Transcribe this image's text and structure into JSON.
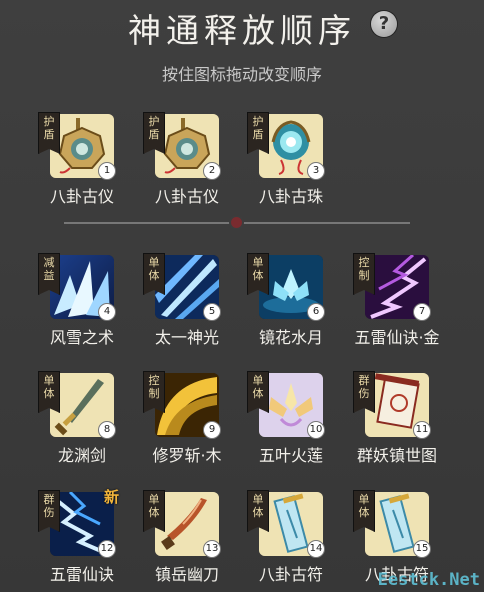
{
  "header": {
    "title": "神通释放顺序",
    "help_icon": "?",
    "subtitle": "按住图标拖动改变顺序"
  },
  "top_skills": [
    {
      "tag": [
        "护",
        "盾"
      ],
      "num": "1",
      "label": "八卦古仪",
      "icon": "bagua-mirror-icon"
    },
    {
      "tag": [
        "护",
        "盾"
      ],
      "num": "2",
      "label": "八卦古仪",
      "icon": "bagua-mirror-icon"
    },
    {
      "tag": [
        "护",
        "盾"
      ],
      "num": "3",
      "label": "八卦古珠",
      "icon": "bagua-orb-icon"
    }
  ],
  "skills": [
    {
      "tag": [
        "减",
        "益"
      ],
      "num": "4",
      "label": "风雪之术",
      "icon": "ice-crystal-icon"
    },
    {
      "tag": [
        "单",
        "体"
      ],
      "num": "5",
      "label": "太一神光",
      "icon": "light-beam-icon"
    },
    {
      "tag": [
        "单",
        "体"
      ],
      "num": "6",
      "label": "镜花水月",
      "icon": "water-lotus-icon"
    },
    {
      "tag": [
        "控",
        "制"
      ],
      "num": "7",
      "label": "五雷仙诀·金",
      "icon": "purple-lightning-icon"
    },
    {
      "tag": [
        "单",
        "体"
      ],
      "num": "8",
      "label": "龙渊剑",
      "icon": "sword-icon"
    },
    {
      "tag": [
        "控",
        "制"
      ],
      "num": "9",
      "label": "修罗斩·木",
      "icon": "golden-slash-icon"
    },
    {
      "tag": [
        "单",
        "体"
      ],
      "num": "10",
      "label": "五叶火莲",
      "icon": "fire-lotus-icon"
    },
    {
      "tag": [
        "群",
        "伤"
      ],
      "num": "11",
      "label": "群妖镇世图",
      "icon": "scroll-icon"
    },
    {
      "tag": [
        "群",
        "伤"
      ],
      "num": "12",
      "label": "五雷仙诀",
      "icon": "blue-lightning-icon",
      "new": "新"
    },
    {
      "tag": [
        "单",
        "体"
      ],
      "num": "13",
      "label": "镇岳幽刀",
      "icon": "blade-icon"
    },
    {
      "tag": [
        "单",
        "体"
      ],
      "num": "14",
      "label": "八卦古符",
      "icon": "talisman-icon"
    },
    {
      "tag": [
        "单",
        "体"
      ],
      "num": "15",
      "label": "八卦古符",
      "icon": "talisman-icon"
    }
  ],
  "watermark": "Eestck.Net"
}
